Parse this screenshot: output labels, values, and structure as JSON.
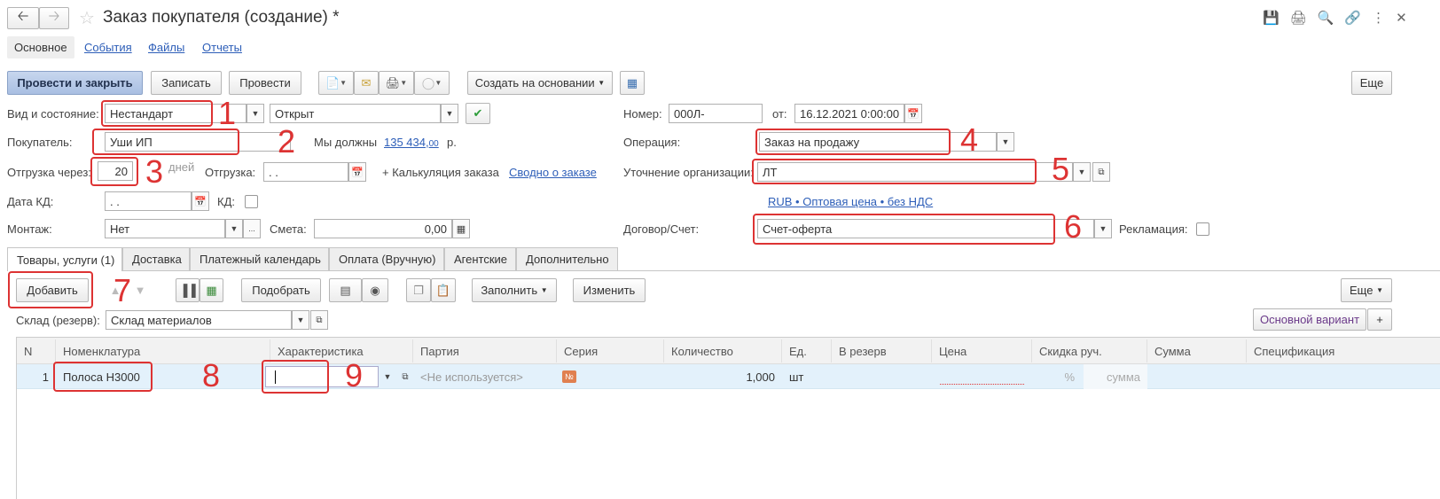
{
  "window": {
    "title": "Заказ покупателя (создание) *",
    "tabs": [
      "Основное",
      "События",
      "Файлы",
      "Отчеты"
    ]
  },
  "toolbar": {
    "post_close": "Провести и закрыть",
    "save": "Записать",
    "post": "Провести",
    "create_based": "Создать на основании",
    "more": "Еще"
  },
  "form": {
    "kind_label": "Вид и состояние:",
    "kind_value": "Нестандарт",
    "state_value": "Открыт",
    "number_label": "Номер:",
    "number_value": "000Л-",
    "from_label": "от:",
    "date_value": "16.12.2021  0:00:00",
    "buyer_label": "Покупатель:",
    "buyer_value": "Уши ИП",
    "we_owe_label": "Мы должны",
    "we_owe_value": "135 434,",
    "we_owe_cents": "00",
    "we_owe_unit": "р.",
    "operation_label": "Операция:",
    "operation_value": "Заказ на продажу",
    "ship_in_label": "Отгрузка через:",
    "ship_in_value": "20",
    "ship_in_unit": "дней",
    "shipment_label": "Отгрузка:",
    "shipment_value": ". .",
    "calc_link": "+ Калькуляция заказа",
    "summary_link": "Сводно о заказе",
    "org_label": "Уточнение организации:",
    "org_value": "ЛТ",
    "kd_date_label": "Дата КД:",
    "kd_date_value": ". .",
    "kd_label": "КД:",
    "price_link": "RUB • Оптовая цена • без НДС",
    "mount_label": "Монтаж:",
    "mount_value": "Нет",
    "estimate_label": "Смета:",
    "estimate_value": "0,00",
    "contract_label": "Договор/Счет:",
    "contract_value": "Счет-оферта",
    "reclamation_label": "Рекламация:"
  },
  "tabs": [
    "Товары, услуги (1)",
    "Доставка",
    "Платежный календарь",
    "Оплата (Вручную)",
    "Агентские",
    "Дополнительно"
  ],
  "items_toolbar": {
    "add": "Добавить",
    "pick": "Подобрать",
    "fill": "Заполнить",
    "change": "Изменить",
    "more": "Еще"
  },
  "warehouse": {
    "label": "Склад (резерв):",
    "value": "Склад материалов",
    "variant": "Основной вариант",
    "plus": "+"
  },
  "table": {
    "columns": [
      "N",
      "Номенклатура",
      "Характеристика",
      "Партия",
      "Серия",
      "Количество",
      "Ед.",
      "В резерв",
      "Цена",
      "Скидка руч.",
      "Сумма",
      "Спецификация"
    ],
    "rows": [
      {
        "n": "1",
        "nomenclature": "Полоса Н3000",
        "characteristic": "",
        "batch": "<Не используется>",
        "series_icon": "№",
        "quantity": "1,000",
        "unit": "шт",
        "reserve": "",
        "price": "",
        "discount_pct": "%",
        "discount_sum": "сумма",
        "sum": "",
        "spec": ""
      }
    ]
  },
  "annotations": [
    "1",
    "2",
    "3",
    "4",
    "5",
    "6",
    "7",
    "8",
    "9"
  ],
  "colors": {
    "annotation": "#d33333",
    "link": "#2d5eb8",
    "primary_button": "#a9bfe2",
    "selected_row": "#e3f1fb"
  }
}
